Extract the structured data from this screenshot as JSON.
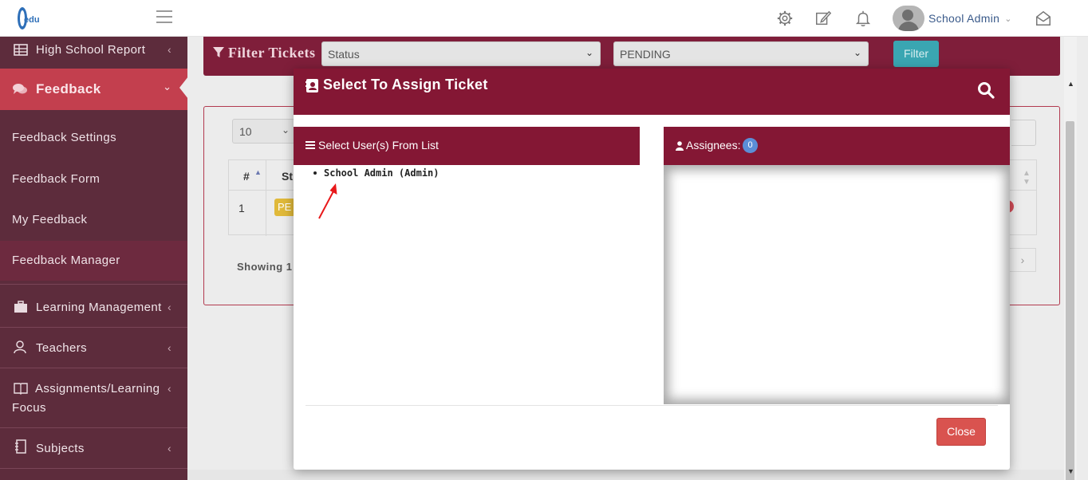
{
  "topbar": {
    "user_name": "School Admin"
  },
  "sidebar": {
    "items": [
      {
        "label": "High School Report"
      },
      {
        "label": "Feedback"
      },
      {
        "label": "Learning Management"
      },
      {
        "label": "Teachers"
      },
      {
        "label": "Assignments/Learning"
      },
      {
        "label": "Subjects"
      }
    ],
    "assignments_line2": "Focus",
    "feedback_sub": [
      {
        "label": "Feedback Settings"
      },
      {
        "label": "Feedback Form"
      },
      {
        "label": "My Feedback"
      },
      {
        "label": "Feedback Manager"
      }
    ]
  },
  "filter": {
    "title": "Filter Tickets",
    "status_select": "Status",
    "value_select": "PENDING",
    "button": "Filter"
  },
  "table": {
    "length": "10",
    "col_num": "#",
    "col_status": "St",
    "row_num": "1",
    "row_badge": "PE",
    "showing": "Showing 1"
  },
  "modal": {
    "title": "Select To Assign Ticket",
    "left_panel": "Select User(s) From List",
    "right_panel": "Assignees:",
    "assignee_count": "0",
    "users": [
      "School Admin (Admin)"
    ],
    "close": "Close"
  },
  "colors": {
    "sidebar": "#5d2c3c",
    "accent": "#841734",
    "feedback_active": "#c33f4e",
    "filter_button": "#3aa6b2",
    "close_button": "#d9534f"
  }
}
